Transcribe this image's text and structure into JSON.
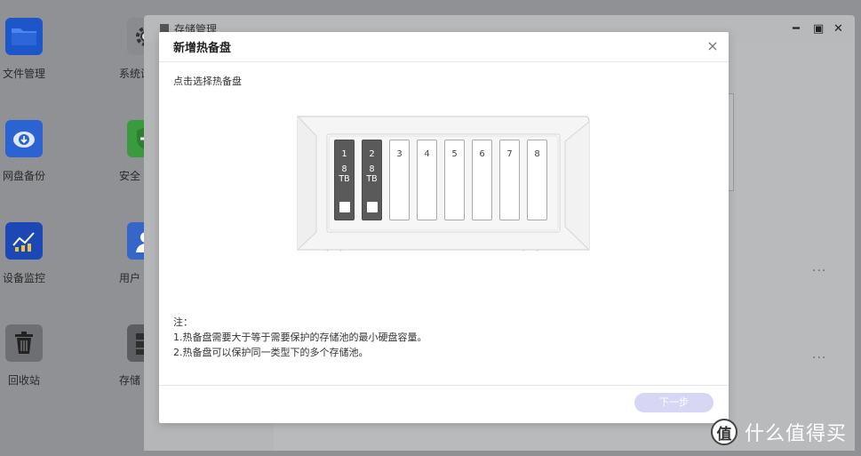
{
  "desktop": {
    "icons": [
      {
        "label": "文件管理",
        "icon": "folder-icon"
      },
      {
        "label": "网盘备份",
        "icon": "cloud-download-icon"
      },
      {
        "label": "设备监控",
        "icon": "chart-icon"
      },
      {
        "label": "回收站",
        "icon": "trash-icon"
      },
      {
        "label": "系统设",
        "icon": "gear-icon"
      },
      {
        "label": "安全",
        "icon": "shield-icon"
      },
      {
        "label": "用户",
        "icon": "user-icon"
      },
      {
        "label": "存储",
        "icon": "storage-icon"
      }
    ]
  },
  "background_window": {
    "title": "存储管理",
    "more_label": "..."
  },
  "modal": {
    "title": "新增热备盘",
    "close_glyph": "×",
    "instruction": "点击选择热备盘",
    "bays": [
      {
        "number": "1",
        "size": "8",
        "unit": "TB",
        "state": "occupied"
      },
      {
        "number": "2",
        "size": "8",
        "unit": "TB",
        "state": "occupied"
      },
      {
        "number": "3",
        "state": "empty"
      },
      {
        "number": "4",
        "state": "empty"
      },
      {
        "number": "5",
        "state": "empty"
      },
      {
        "number": "6",
        "state": "empty"
      },
      {
        "number": "7",
        "state": "empty"
      },
      {
        "number": "8",
        "state": "empty"
      }
    ],
    "notes": {
      "heading": "注：",
      "line1": "1.热备盘需要大于等于需要保护的存储池的最小硬盘容量。",
      "line2": "2.热备盘可以保护同一类型下的多个存储池。"
    },
    "next_button": "下一步"
  },
  "watermark": {
    "logo": "值",
    "text": "什么值得买"
  },
  "colors": {
    "accent_disabled": "#d7d7f5",
    "bay_occupied": "#5a5a5a"
  }
}
